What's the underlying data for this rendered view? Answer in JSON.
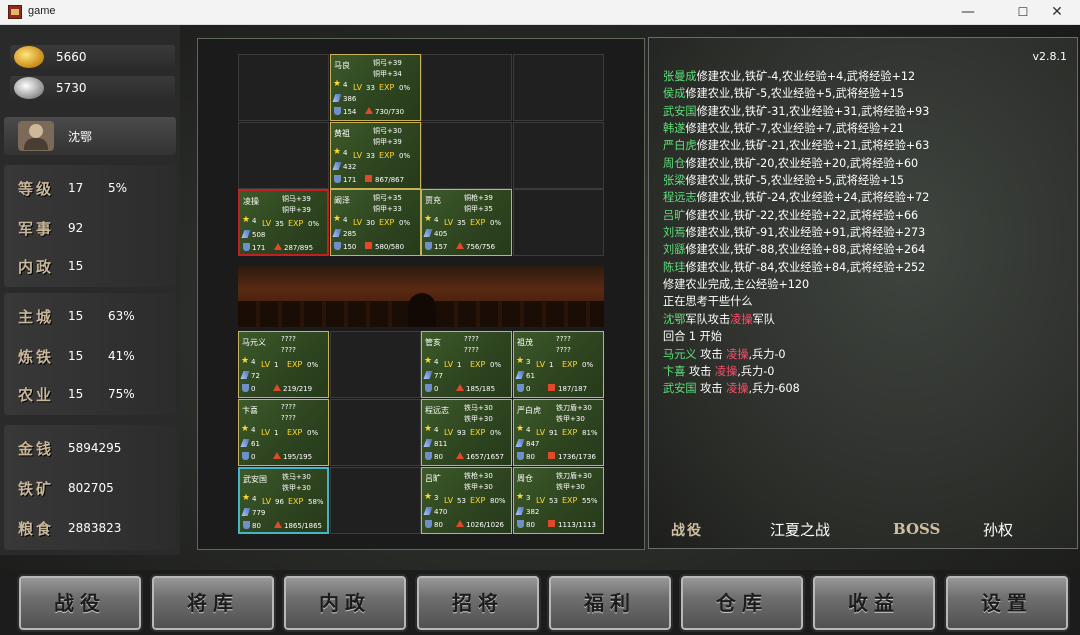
{
  "window": {
    "title": "game",
    "min": "—",
    "max": "☐",
    "close": "✕"
  },
  "resources": {
    "gold_ingot": "5660",
    "silver_ingot": "5730"
  },
  "lord": {
    "name": "沈鄂"
  },
  "stats": {
    "level": {
      "label": "等级",
      "value": "17",
      "pct": "5%"
    },
    "military": {
      "label": "军事",
      "value": "92"
    },
    "politics": {
      "label": "内政",
      "value": "15"
    },
    "main_city": {
      "label": "主城",
      "value": "15",
      "pct": "63%"
    },
    "smelting": {
      "label": "炼铁",
      "value": "15",
      "pct": "41%"
    },
    "farming": {
      "label": "农业",
      "value": "15",
      "pct": "75%"
    },
    "money": {
      "label": "金钱",
      "value": "5894295"
    },
    "iron": {
      "label": "铁矿",
      "value": "802705"
    },
    "grain": {
      "label": "粮食",
      "value": "2883823"
    }
  },
  "card_labels": {
    "lv": "LV",
    "exp": "EXP"
  },
  "enemy_cards": [
    {
      "name": "马良",
      "eq1": "铜弓+39",
      "eq2": "铜甲+34",
      "star": "4",
      "lv": "33",
      "exp": "0%",
      "atk": "386",
      "def": "154",
      "hp": "730/730",
      "icon": "tri"
    },
    {
      "name": "黄祖",
      "eq1": "铜弓+30",
      "eq2": "铜甲+39",
      "star": "4",
      "lv": "33",
      "exp": "0%",
      "atk": "432",
      "def": "171",
      "hp": "867/867",
      "icon": "sq"
    },
    {
      "name": "凌操",
      "eq1": "铜马+39",
      "eq2": "铜甲+39",
      "star": "4",
      "lv": "35",
      "exp": "0%",
      "atk": "508",
      "def": "171",
      "hp": "287/895",
      "icon": "tri"
    },
    {
      "name": "阚泽",
      "eq1": "铜弓+35",
      "eq2": "铜甲+33",
      "star": "4",
      "lv": "30",
      "exp": "0%",
      "atk": "285",
      "def": "150",
      "hp": "580/580",
      "icon": "sq"
    },
    {
      "name": "贾充",
      "eq1": "铜枪+39",
      "eq2": "铜甲+35",
      "star": "4",
      "lv": "35",
      "exp": "0%",
      "atk": "405",
      "def": "157",
      "hp": "756/756",
      "icon": "tri"
    }
  ],
  "player_cards": [
    {
      "name": "马元义",
      "eq1": "????",
      "eq2": "????",
      "star": "4",
      "lv": "1",
      "exp": "0%",
      "atk": "72",
      "def": "0",
      "hp": "219/219",
      "icon": "tri"
    },
    {
      "name": "管亥",
      "eq1": "????",
      "eq2": "????",
      "star": "4",
      "lv": "1",
      "exp": "0%",
      "atk": "77",
      "def": "0",
      "hp": "185/185",
      "icon": "tri"
    },
    {
      "name": "祖茂",
      "eq1": "????",
      "eq2": "????",
      "star": "3",
      "lv": "1",
      "exp": "0%",
      "atk": "61",
      "def": "0",
      "hp": "187/187",
      "icon": "sq"
    },
    {
      "name": "卞喜",
      "eq1": "????",
      "eq2": "????",
      "star": "4",
      "lv": "1",
      "exp": "0%",
      "atk": "61",
      "def": "0",
      "hp": "195/195",
      "icon": "tri"
    },
    {
      "name": "程远志",
      "eq1": "铁马+30",
      "eq2": "铁甲+30",
      "star": "4",
      "lv": "93",
      "exp": "0%",
      "atk": "811",
      "def": "80",
      "hp": "1657/1657",
      "icon": "tri"
    },
    {
      "name": "严白虎",
      "eq1": "铁刀盾+30",
      "eq2": "铁甲+30",
      "star": "4",
      "lv": "91",
      "exp": "81%",
      "atk": "847",
      "def": "80",
      "hp": "1736/1736",
      "icon": "sq"
    },
    {
      "name": "武安国",
      "eq1": "铁马+30",
      "eq2": "铁甲+30",
      "star": "4",
      "lv": "96",
      "exp": "58%",
      "atk": "779",
      "def": "80",
      "hp": "1865/1865",
      "icon": "tri"
    },
    {
      "name": "吕旷",
      "eq1": "铁枪+30",
      "eq2": "铁甲+30",
      "star": "3",
      "lv": "53",
      "exp": "80%",
      "atk": "470",
      "def": "80",
      "hp": "1026/1026",
      "icon": "tri"
    },
    {
      "name": "周仓",
      "eq1": "铁刀盾+30",
      "eq2": "铁甲+30",
      "star": "3",
      "lv": "53",
      "exp": "55%",
      "atk": "382",
      "def": "80",
      "hp": "1113/1113",
      "icon": "sq"
    }
  ],
  "version": "v2.8.1",
  "log": [
    {
      "who": "张曼成",
      "text": "修建农业,铁矿-4,农业经验+4,武将经验+12"
    },
    {
      "who": "侯成",
      "text": "修建农业,铁矿-5,农业经验+5,武将经验+15"
    },
    {
      "who": "武安国",
      "text": "修建农业,铁矿-31,农业经验+31,武将经验+93"
    },
    {
      "who": "韩遂",
      "text": "修建农业,铁矿-7,农业经验+7,武将经验+21"
    },
    {
      "who": "严白虎",
      "text": "修建农业,铁矿-21,农业经验+21,武将经验+63"
    },
    {
      "who": "周仓",
      "text": "修建农业,铁矿-20,农业经验+20,武将经验+60"
    },
    {
      "who": "张梁",
      "text": "修建农业,铁矿-5,农业经验+5,武将经验+15"
    },
    {
      "who": "程远志",
      "text": "修建农业,铁矿-24,农业经验+24,武将经验+72"
    },
    {
      "who": "吕旷",
      "text": "修建农业,铁矿-22,农业经验+22,武将经验+66"
    },
    {
      "who": "刘焉",
      "text": "修建农业,铁矿-91,农业经验+91,武将经验+273"
    },
    {
      "who": "刘繇",
      "text": "修建农业,铁矿-88,农业经验+88,武将经验+264"
    },
    {
      "who": "陈珪",
      "text": "修建农业,铁矿-84,农业经验+84,武将经验+252"
    },
    {
      "who": "",
      "text": "修建农业完成,主公经验+120"
    },
    {
      "who": "",
      "text": "正在思考干些什么"
    },
    {
      "who": "沈鄂",
      "text": "军队攻击",
      "target": "凌操",
      "tail": "军队"
    },
    {
      "who": "",
      "text": "回合 1 开始"
    },
    {
      "who": "马元义",
      "text": " 攻击 ",
      "target": "凌操",
      "tail": ",兵力-0"
    },
    {
      "who": "卞喜",
      "text": " 攻击 ",
      "target": "凌操",
      "tail": ",兵力-0"
    },
    {
      "who": "武安国",
      "text": " 攻击 ",
      "target": "凌操",
      "tail": ",兵力-608"
    }
  ],
  "battle": {
    "label": "战役",
    "name": "江夏之战",
    "boss_label": "BOSS",
    "boss_name": "孙权"
  },
  "menu": [
    "战役",
    "将库",
    "内政",
    "招将",
    "福利",
    "仓库",
    "收益",
    "设置"
  ]
}
